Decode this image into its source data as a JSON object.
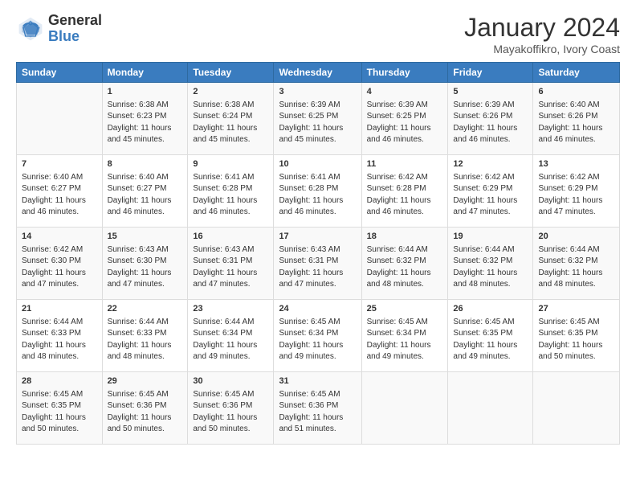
{
  "header": {
    "logo_general": "General",
    "logo_blue": "Blue",
    "month_title": "January 2024",
    "subtitle": "Mayakoffikro, Ivory Coast"
  },
  "days_of_week": [
    "Sunday",
    "Monday",
    "Tuesday",
    "Wednesday",
    "Thursday",
    "Friday",
    "Saturday"
  ],
  "weeks": [
    [
      {
        "day": "",
        "sunrise": "",
        "sunset": "",
        "daylight": ""
      },
      {
        "day": "1",
        "sunrise": "Sunrise: 6:38 AM",
        "sunset": "Sunset: 6:23 PM",
        "daylight": "Daylight: 11 hours and 45 minutes."
      },
      {
        "day": "2",
        "sunrise": "Sunrise: 6:38 AM",
        "sunset": "Sunset: 6:24 PM",
        "daylight": "Daylight: 11 hours and 45 minutes."
      },
      {
        "day": "3",
        "sunrise": "Sunrise: 6:39 AM",
        "sunset": "Sunset: 6:25 PM",
        "daylight": "Daylight: 11 hours and 45 minutes."
      },
      {
        "day": "4",
        "sunrise": "Sunrise: 6:39 AM",
        "sunset": "Sunset: 6:25 PM",
        "daylight": "Daylight: 11 hours and 46 minutes."
      },
      {
        "day": "5",
        "sunrise": "Sunrise: 6:39 AM",
        "sunset": "Sunset: 6:26 PM",
        "daylight": "Daylight: 11 hours and 46 minutes."
      },
      {
        "day": "6",
        "sunrise": "Sunrise: 6:40 AM",
        "sunset": "Sunset: 6:26 PM",
        "daylight": "Daylight: 11 hours and 46 minutes."
      }
    ],
    [
      {
        "day": "7",
        "sunrise": "Sunrise: 6:40 AM",
        "sunset": "Sunset: 6:27 PM",
        "daylight": "Daylight: 11 hours and 46 minutes."
      },
      {
        "day": "8",
        "sunrise": "Sunrise: 6:40 AM",
        "sunset": "Sunset: 6:27 PM",
        "daylight": "Daylight: 11 hours and 46 minutes."
      },
      {
        "day": "9",
        "sunrise": "Sunrise: 6:41 AM",
        "sunset": "Sunset: 6:28 PM",
        "daylight": "Daylight: 11 hours and 46 minutes."
      },
      {
        "day": "10",
        "sunrise": "Sunrise: 6:41 AM",
        "sunset": "Sunset: 6:28 PM",
        "daylight": "Daylight: 11 hours and 46 minutes."
      },
      {
        "day": "11",
        "sunrise": "Sunrise: 6:42 AM",
        "sunset": "Sunset: 6:28 PM",
        "daylight": "Daylight: 11 hours and 46 minutes."
      },
      {
        "day": "12",
        "sunrise": "Sunrise: 6:42 AM",
        "sunset": "Sunset: 6:29 PM",
        "daylight": "Daylight: 11 hours and 47 minutes."
      },
      {
        "day": "13",
        "sunrise": "Sunrise: 6:42 AM",
        "sunset": "Sunset: 6:29 PM",
        "daylight": "Daylight: 11 hours and 47 minutes."
      }
    ],
    [
      {
        "day": "14",
        "sunrise": "Sunrise: 6:42 AM",
        "sunset": "Sunset: 6:30 PM",
        "daylight": "Daylight: 11 hours and 47 minutes."
      },
      {
        "day": "15",
        "sunrise": "Sunrise: 6:43 AM",
        "sunset": "Sunset: 6:30 PM",
        "daylight": "Daylight: 11 hours and 47 minutes."
      },
      {
        "day": "16",
        "sunrise": "Sunrise: 6:43 AM",
        "sunset": "Sunset: 6:31 PM",
        "daylight": "Daylight: 11 hours and 47 minutes."
      },
      {
        "day": "17",
        "sunrise": "Sunrise: 6:43 AM",
        "sunset": "Sunset: 6:31 PM",
        "daylight": "Daylight: 11 hours and 47 minutes."
      },
      {
        "day": "18",
        "sunrise": "Sunrise: 6:44 AM",
        "sunset": "Sunset: 6:32 PM",
        "daylight": "Daylight: 11 hours and 48 minutes."
      },
      {
        "day": "19",
        "sunrise": "Sunrise: 6:44 AM",
        "sunset": "Sunset: 6:32 PM",
        "daylight": "Daylight: 11 hours and 48 minutes."
      },
      {
        "day": "20",
        "sunrise": "Sunrise: 6:44 AM",
        "sunset": "Sunset: 6:32 PM",
        "daylight": "Daylight: 11 hours and 48 minutes."
      }
    ],
    [
      {
        "day": "21",
        "sunrise": "Sunrise: 6:44 AM",
        "sunset": "Sunset: 6:33 PM",
        "daylight": "Daylight: 11 hours and 48 minutes."
      },
      {
        "day": "22",
        "sunrise": "Sunrise: 6:44 AM",
        "sunset": "Sunset: 6:33 PM",
        "daylight": "Daylight: 11 hours and 48 minutes."
      },
      {
        "day": "23",
        "sunrise": "Sunrise: 6:44 AM",
        "sunset": "Sunset: 6:34 PM",
        "daylight": "Daylight: 11 hours and 49 minutes."
      },
      {
        "day": "24",
        "sunrise": "Sunrise: 6:45 AM",
        "sunset": "Sunset: 6:34 PM",
        "daylight": "Daylight: 11 hours and 49 minutes."
      },
      {
        "day": "25",
        "sunrise": "Sunrise: 6:45 AM",
        "sunset": "Sunset: 6:34 PM",
        "daylight": "Daylight: 11 hours and 49 minutes."
      },
      {
        "day": "26",
        "sunrise": "Sunrise: 6:45 AM",
        "sunset": "Sunset: 6:35 PM",
        "daylight": "Daylight: 11 hours and 49 minutes."
      },
      {
        "day": "27",
        "sunrise": "Sunrise: 6:45 AM",
        "sunset": "Sunset: 6:35 PM",
        "daylight": "Daylight: 11 hours and 50 minutes."
      }
    ],
    [
      {
        "day": "28",
        "sunrise": "Sunrise: 6:45 AM",
        "sunset": "Sunset: 6:35 PM",
        "daylight": "Daylight: 11 hours and 50 minutes."
      },
      {
        "day": "29",
        "sunrise": "Sunrise: 6:45 AM",
        "sunset": "Sunset: 6:36 PM",
        "daylight": "Daylight: 11 hours and 50 minutes."
      },
      {
        "day": "30",
        "sunrise": "Sunrise: 6:45 AM",
        "sunset": "Sunset: 6:36 PM",
        "daylight": "Daylight: 11 hours and 50 minutes."
      },
      {
        "day": "31",
        "sunrise": "Sunrise: 6:45 AM",
        "sunset": "Sunset: 6:36 PM",
        "daylight": "Daylight: 11 hours and 51 minutes."
      },
      {
        "day": "",
        "sunrise": "",
        "sunset": "",
        "daylight": ""
      },
      {
        "day": "",
        "sunrise": "",
        "sunset": "",
        "daylight": ""
      },
      {
        "day": "",
        "sunrise": "",
        "sunset": "",
        "daylight": ""
      }
    ]
  ]
}
